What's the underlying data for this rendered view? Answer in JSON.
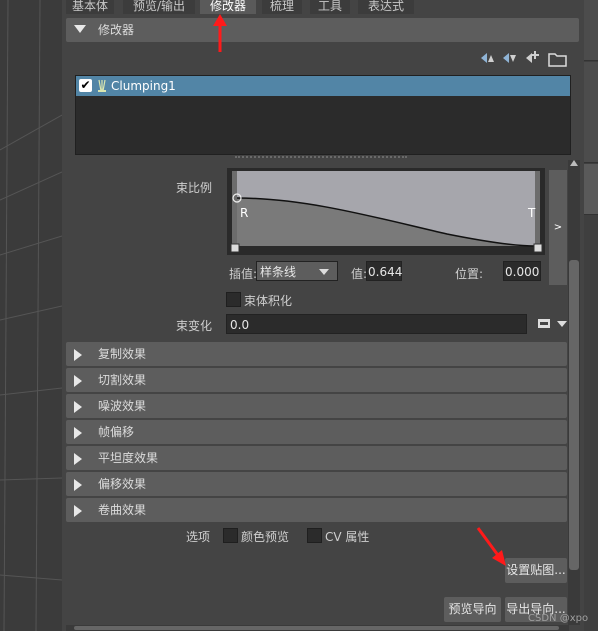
{
  "tabs": [
    "基本体",
    "预览/输出",
    "修改器",
    "梳理",
    "工具",
    "表达式"
  ],
  "active_tab": "修改器",
  "modifier_frame": {
    "label": "修改器"
  },
  "toolbar_icons": [
    "move-up-icon",
    "move-down-icon",
    "add-modifier-icon",
    "folder-icon"
  ],
  "modifier_list": [
    {
      "name": "Clumping1",
      "checked": true
    }
  ],
  "clump_ratio": {
    "label": "束比例",
    "curve_start_label": "R",
    "curve_end_label": "T",
    "expand_label": ">",
    "interp_label": "插值:",
    "interp_value": "样条线",
    "value_label": "值:",
    "value": "0.644",
    "position_label": "位置:",
    "position": "0.000"
  },
  "volume_clump": {
    "label": "束体积化",
    "checked": false
  },
  "clump_variance": {
    "label": "束变化",
    "value": "0.0"
  },
  "sections": [
    "复制效果",
    "切割效果",
    "噪波效果",
    "帧偏移",
    "平坦度效果",
    "偏移效果",
    "卷曲效果"
  ],
  "options": {
    "label": "选项",
    "color_preview": "颜色预览",
    "cv_attrs": "CV 属性"
  },
  "buttons": {
    "set_map": "设置贴图...",
    "preview_guides": "预览导向",
    "export_guides": "导出导向..."
  },
  "watermark": "CSDN @xpo",
  "colors": {
    "accent": "#5285a6",
    "annotation": "#ff1a1a"
  }
}
